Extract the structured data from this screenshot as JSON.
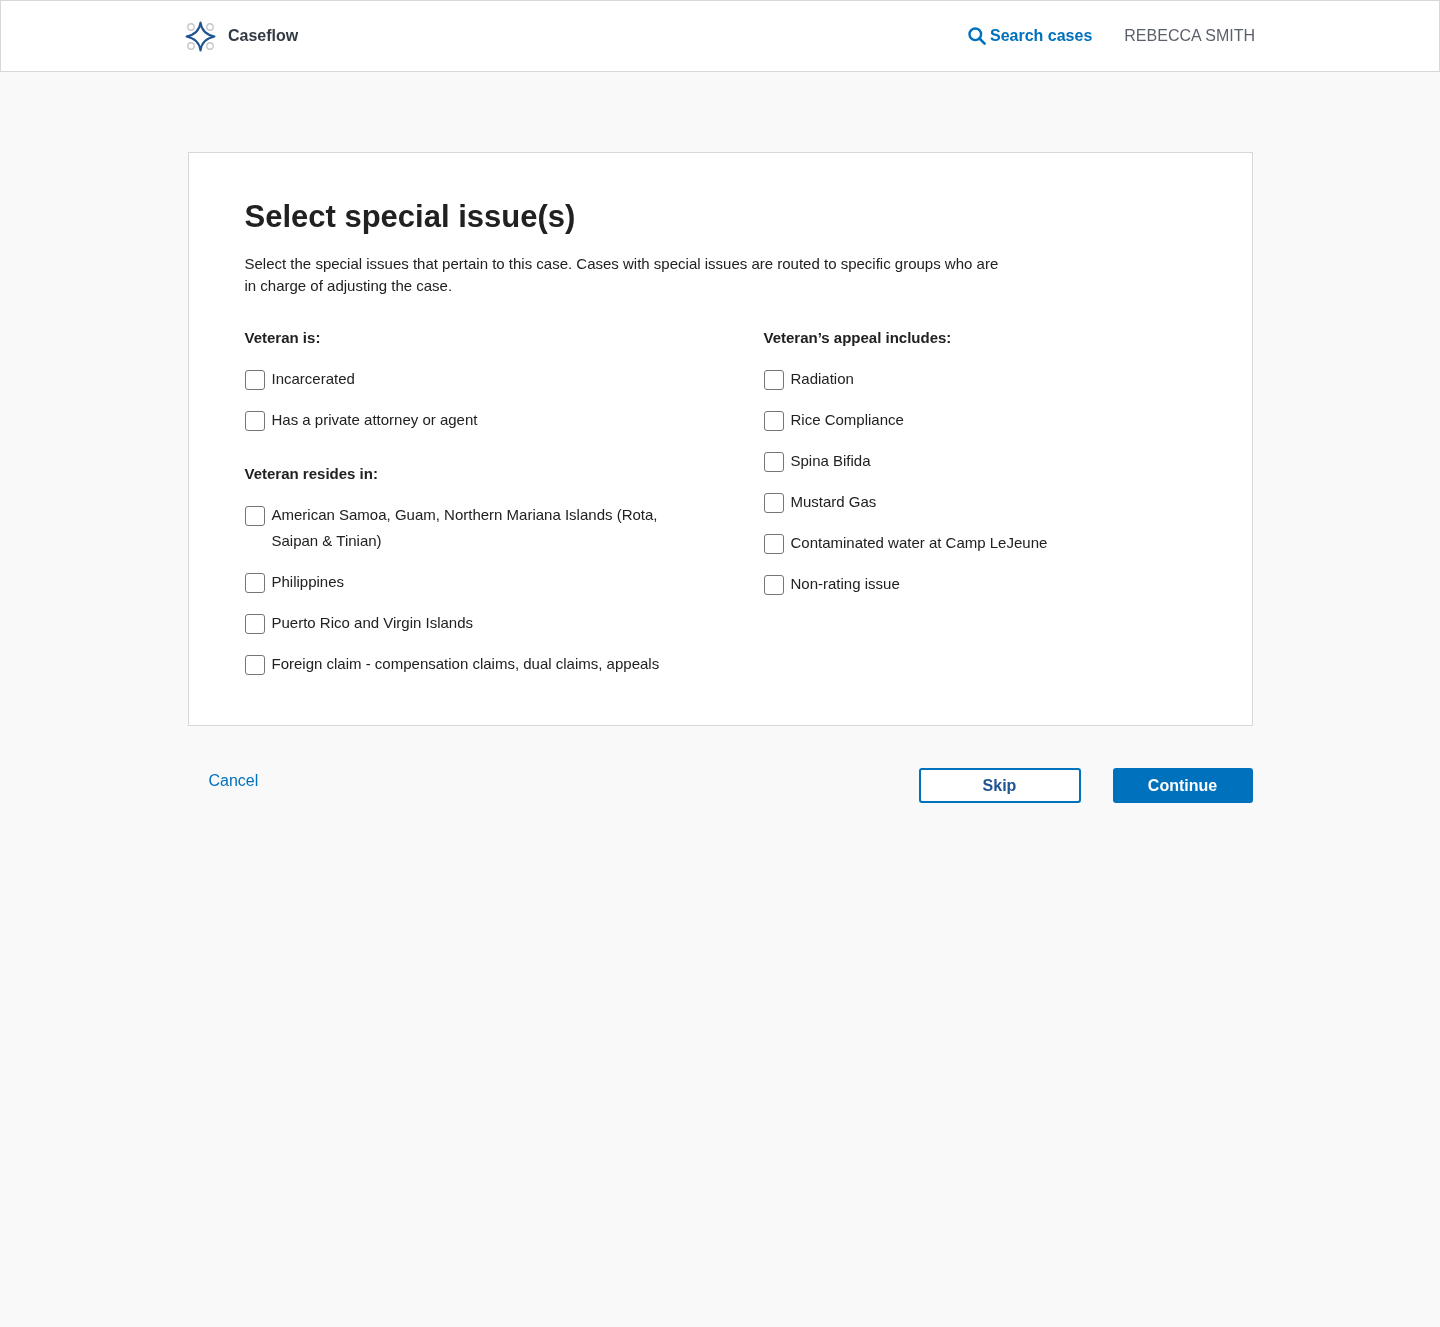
{
  "header": {
    "app_name": "Caseflow",
    "search_link": "Search cases",
    "user_name": "REBECCA SMITH"
  },
  "form": {
    "title": "Select special issue(s)",
    "description": "Select the special issues that pertain to this case. Cases with special issues are routed to specific groups who are in charge of adjusting the case.",
    "columns": [
      {
        "groups": [
          {
            "heading": "Veteran is:",
            "options": [
              {
                "label": "Incarcerated",
                "checked": false
              },
              {
                "label": "Has a private attorney or agent",
                "checked": false
              }
            ]
          },
          {
            "heading": "Veteran resides in:",
            "options": [
              {
                "label": "American Samoa, Guam, Northern Mariana Islands (Rota, Saipan & Tinian)",
                "checked": false
              },
              {
                "label": "Philippines",
                "checked": false
              },
              {
                "label": "Puerto Rico and Virgin Islands",
                "checked": false
              },
              {
                "label": "Foreign claim - compensation claims, dual claims, appeals",
                "checked": false
              }
            ]
          }
        ]
      },
      {
        "groups": [
          {
            "heading": "Veteran’s appeal includes:",
            "options": [
              {
                "label": "Radiation",
                "checked": false
              },
              {
                "label": "Rice Compliance",
                "checked": false
              },
              {
                "label": "Spina Bifida",
                "checked": false
              },
              {
                "label": "Mustard Gas",
                "checked": false
              },
              {
                "label": "Contaminated water at Camp LeJeune",
                "checked": false
              },
              {
                "label": "Non-rating issue",
                "checked": false
              }
            ]
          }
        ]
      }
    ]
  },
  "actions": {
    "cancel": "Cancel",
    "skip": "Skip",
    "continue": "Continue"
  }
}
